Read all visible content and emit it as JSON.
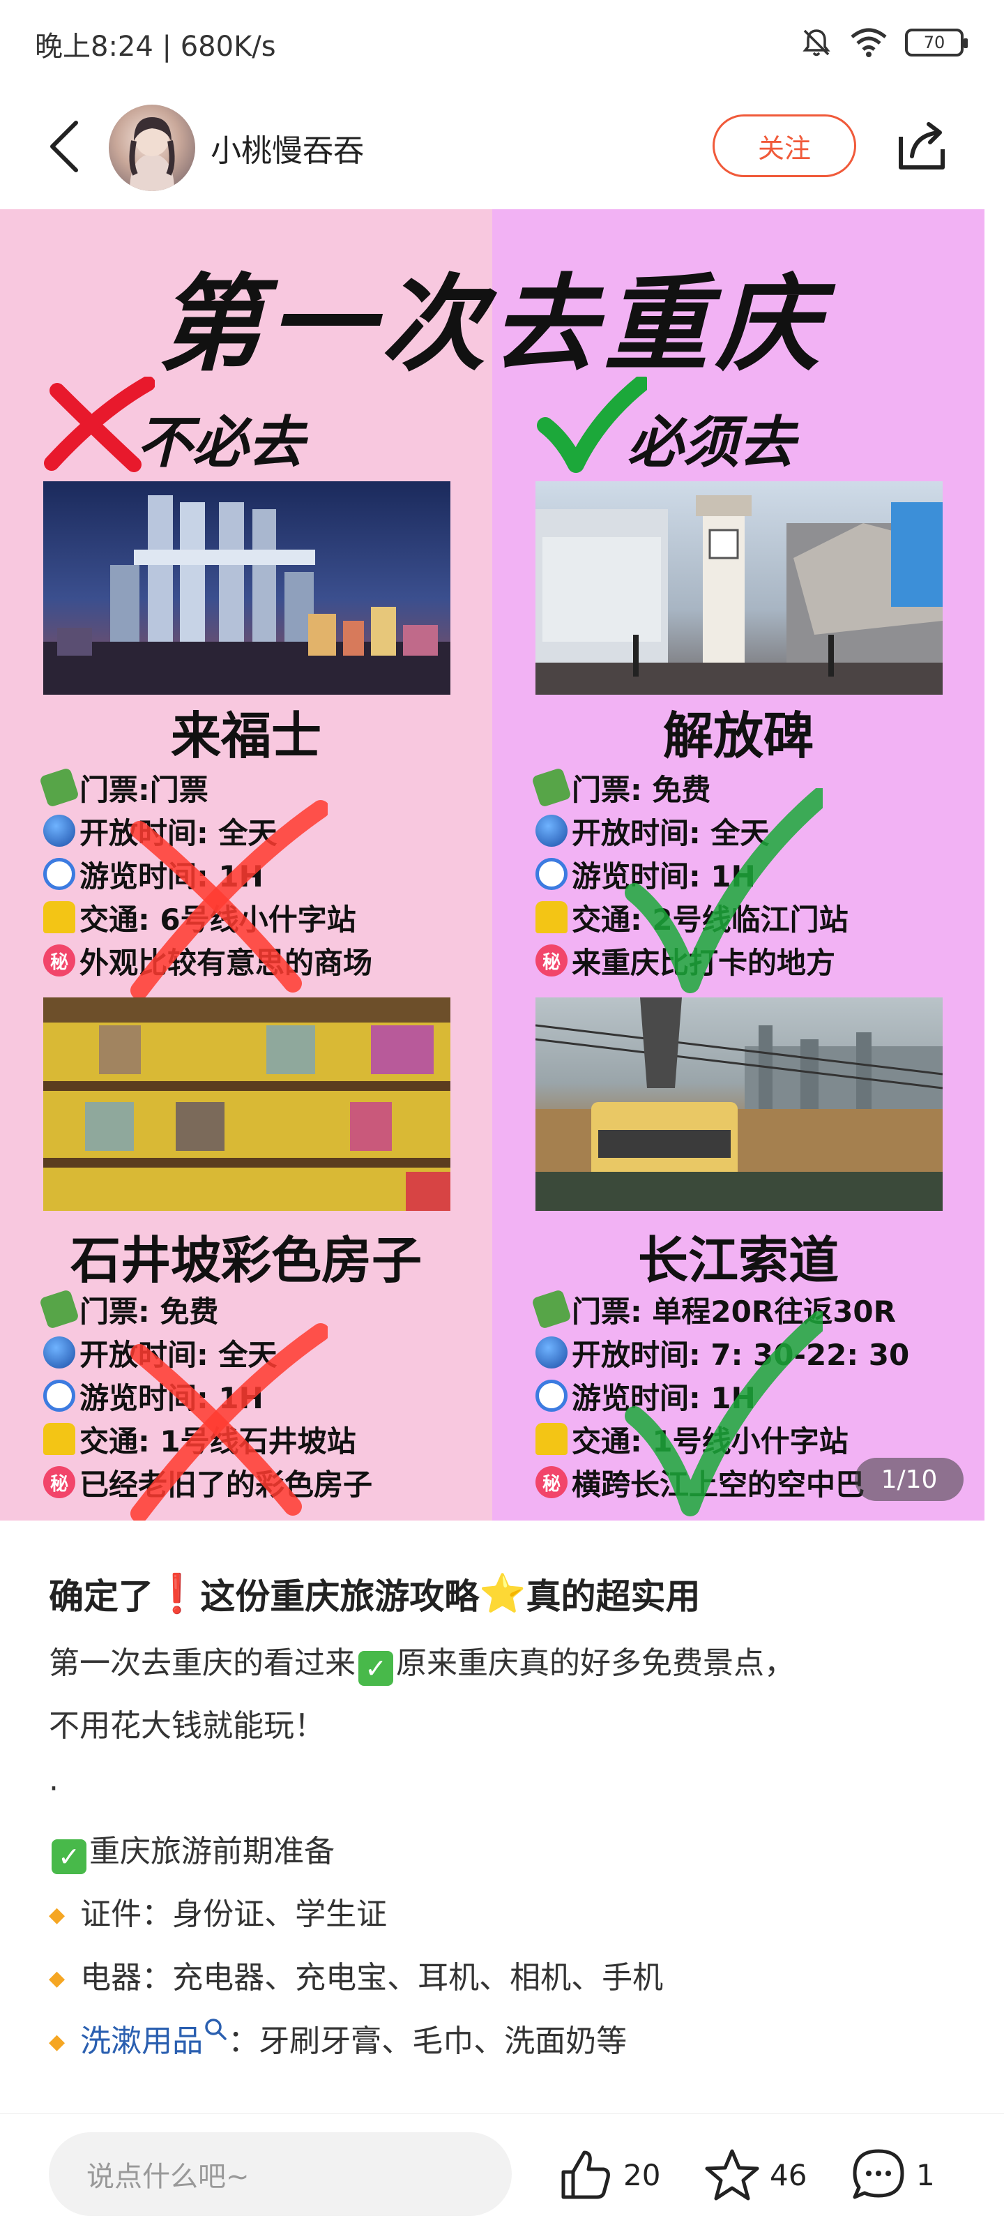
{
  "status_bar": {
    "time_speed": "晚上8:24 | 680K/s",
    "battery": "70"
  },
  "header": {
    "username": "小桃慢吞吞",
    "follow_label": "关注"
  },
  "poster": {
    "title": "第一次去重庆",
    "left_heading": "不必去",
    "right_heading": "必须去",
    "cards": [
      {
        "name": "来福士",
        "lines": [
          "门票:门票",
          "开放时间: 全天",
          "游览时间: 1H",
          "交通: 6号线小什字站",
          "外观比较有意思的商场"
        ]
      },
      {
        "name": "解放碑",
        "lines": [
          "门票: 免费",
          "开放时间: 全天",
          "游览时间: 1H",
          "交通: 2号线临江门站",
          "来重庆比打卡的地方"
        ]
      },
      {
        "name": "石井坡彩色房子",
        "lines": [
          "门票: 免费",
          "开放时间: 全天",
          "游览时间: 1H",
          "交通: 1号线石井坡站",
          "已经老旧了的彩色房子"
        ]
      },
      {
        "name": "长江索道",
        "lines": [
          "门票: 单程20R往返30R",
          "开放时间: 7: 30-22: 30",
          "游览时间: 1H",
          "交通: 1号线小什字站",
          "横跨长江上空的空中巴"
        ]
      }
    ],
    "icon_names": [
      "money-icon",
      "globe-icon",
      "clock-icon",
      "taxi-icon",
      "secret-icon"
    ],
    "secret_glyph": "秘",
    "page_indicator": "1/10"
  },
  "content": {
    "title_part1": "确定了",
    "title_excl": "❗",
    "title_part2": " 这份重庆旅游攻略",
    "title_star": "⭐",
    "title_part3": "真的超实用",
    "intro_part1": "第一次去重庆的看过来",
    "intro_part2": "原来重庆真的好多免费景点，",
    "intro_line2": "不用花大钱就能玩！",
    "dot": "·",
    "section_title": "重庆旅游前期准备",
    "items": [
      {
        "label": "证件：身份证、学生证"
      },
      {
        "label": "电器：充电器、充电宝、耳机、相机、手机"
      }
    ],
    "link_item": {
      "link": "洗漱用品",
      "rest": "：牙刷牙膏、毛巾、洗面奶等"
    },
    "check_glyph": "✓"
  },
  "bottom_bar": {
    "comment_placeholder": "说点什么吧~",
    "like_count": "20",
    "star_count": "46",
    "comment_count": "1"
  },
  "colors": {
    "accent": "#f05a3a",
    "poster_left_bg": "#f8c8df",
    "poster_right_bg": "#f2b2f4",
    "link": "#2a5fb0"
  }
}
